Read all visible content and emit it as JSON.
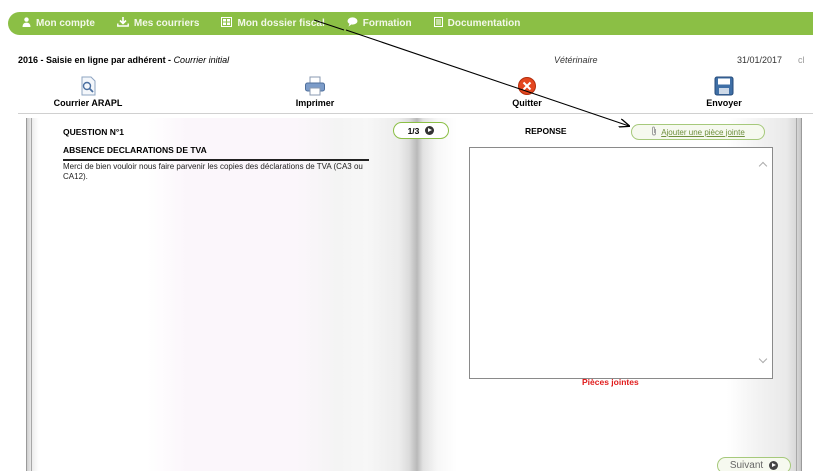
{
  "nav": {
    "items": [
      {
        "label": "Mon compte",
        "icon": "user-icon"
      },
      {
        "label": "Mes courriers",
        "icon": "download-icon"
      },
      {
        "label": "Mon dossier fiscal",
        "icon": "folder-icon"
      },
      {
        "label": "Formation",
        "icon": "speech-bubble-icon"
      },
      {
        "label": "Documentation",
        "icon": "document-icon"
      }
    ]
  },
  "info": {
    "title": "2016 - Saisie en ligne par adhérent - ",
    "subtitle": "Courrier initial",
    "profession": "Vétérinaire",
    "date": "31/01/2017",
    "extra": "cl"
  },
  "toolbar": {
    "courrier_label": "Courrier ARAPL",
    "imprimer_label": "Imprimer",
    "quitter_label": "Quitter",
    "envoyer_label": "Envoyer"
  },
  "question": {
    "number": "QUESTION N°1",
    "title": "ABSENCE DECLARATIONS DE TVA",
    "text": "Merci de bien vouloir nous faire parvenir les copies des déclarations de TVA (CA3 ou CA12)."
  },
  "pager": {
    "text": "1/3"
  },
  "answer": {
    "heading": "REPONSE",
    "attach_label": "Ajouter une pièce jointe",
    "value": ""
  },
  "attachments": {
    "label": "Pièces jointes"
  },
  "next": {
    "label": "Suivant"
  },
  "colors": {
    "nav_green": "#8bbf45",
    "attachments_red": "#e01b1b"
  }
}
